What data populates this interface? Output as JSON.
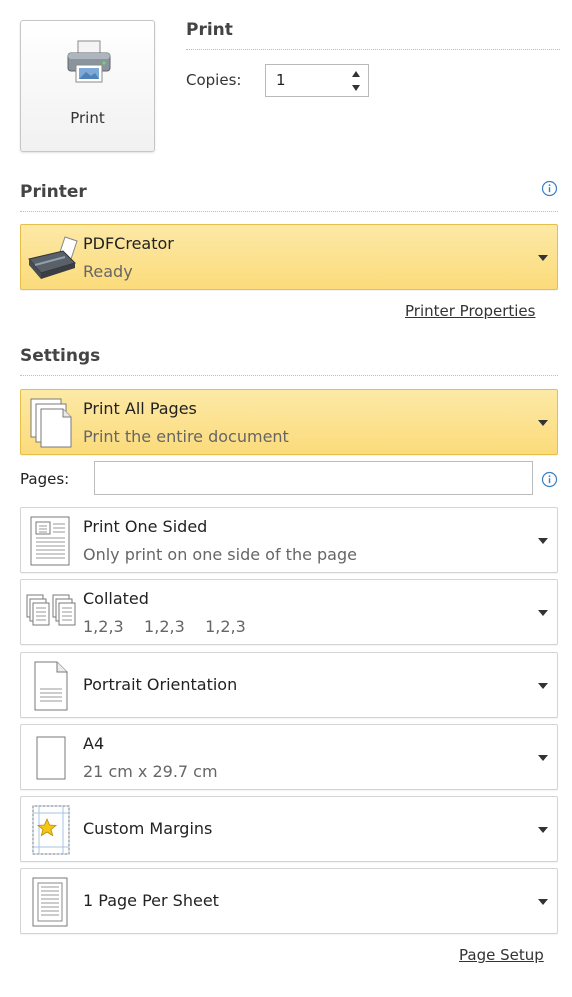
{
  "print": {
    "button_label": "Print",
    "section_title": "Print",
    "copies_label": "Copies:",
    "copies_value": "1"
  },
  "printer": {
    "section_title": "Printer",
    "name": "PDFCreator",
    "status": "Ready",
    "properties_link": "Printer Properties"
  },
  "settings": {
    "section_title": "Settings",
    "pages_label": "Pages:",
    "pages_value": "",
    "options": {
      "range": {
        "title": "Print All Pages",
        "subtitle": "Print the entire document"
      },
      "sides": {
        "title": "Print One Sided",
        "subtitle": "Only print on one side of the page"
      },
      "collation": {
        "title": "Collated",
        "subtitle": "1,2,3    1,2,3    1,2,3"
      },
      "orientation": {
        "title": "Portrait Orientation"
      },
      "paper": {
        "title": "A4",
        "subtitle": "21 cm x 29.7 cm"
      },
      "margins": {
        "title": "Custom Margins"
      },
      "per_sheet": {
        "title": "1 Page Per Sheet"
      }
    },
    "page_setup_link": "Page Setup"
  },
  "colors": {
    "highlight_top": "#fde9a6",
    "highlight_bottom": "#fbdb7b",
    "highlight_border": "#e6be4a",
    "info_blue": "#3b7fc4"
  },
  "icons": {
    "print_button": "printer-icon",
    "printer": "printer-device-icon",
    "range": "pages-stack-icon",
    "sides": "one-sided-page-icon",
    "collation": "collated-pages-icon",
    "orientation": "portrait-page-icon",
    "paper": "blank-page-icon",
    "margins": "margins-star-icon",
    "per_sheet": "one-per-sheet-icon",
    "info": "info-icon"
  }
}
